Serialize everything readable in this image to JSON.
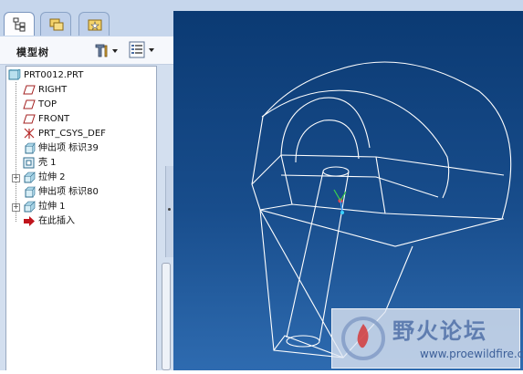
{
  "navigator": {
    "tabs": [
      {
        "icon": "model-tree-tab-icon",
        "active": true
      },
      {
        "icon": "folder-browser-tab-icon",
        "active": false
      },
      {
        "icon": "favorites-tab-icon",
        "active": false
      }
    ],
    "title": "模型树"
  },
  "tree": {
    "items": [
      {
        "label": "PRT0012.PRT",
        "icon": "part-icon"
      },
      {
        "label": "RIGHT",
        "icon": "datum-plane-icon"
      },
      {
        "label": "TOP",
        "icon": "datum-plane-icon"
      },
      {
        "label": "FRONT",
        "icon": "datum-plane-icon"
      },
      {
        "label": "PRT_CSYS_DEF",
        "icon": "coordinate-system-icon"
      },
      {
        "label": "伸出项 标识39",
        "icon": "protrusion-icon"
      },
      {
        "label": "壳 1",
        "icon": "shell-icon"
      },
      {
        "label": "拉伸 2",
        "icon": "extrude-icon"
      },
      {
        "label": "伸出项 标识80",
        "icon": "protrusion-icon"
      },
      {
        "label": "拉伸 1",
        "icon": "extrude-icon"
      },
      {
        "label": "在此插入",
        "icon": "insert-here-arrow-icon"
      }
    ]
  },
  "watermark": {
    "name": "野火论坛",
    "url": "www.proewildfire.cn"
  },
  "colors": {
    "viewport_top": "#0b3a73",
    "viewport_bottom": "#2e6bb0",
    "panel": "#d3dfef",
    "insert_arrow": "#c0141c"
  }
}
